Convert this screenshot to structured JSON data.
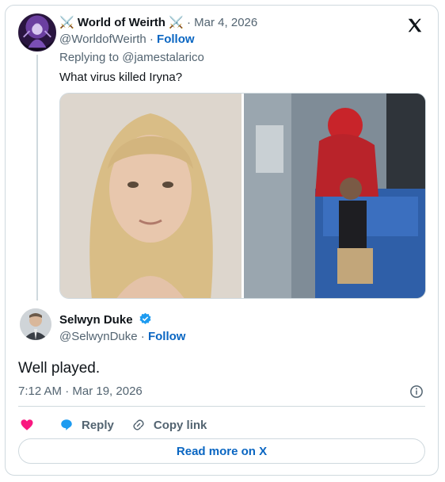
{
  "tweet": {
    "author_name": "World of Weirth",
    "author_emoji_left": "⚔️",
    "author_emoji_right": "⚔️",
    "separator": "·",
    "date": "Mar 4, 2026",
    "handle": "@WorldofWeirth",
    "follow_label": "Follow",
    "replying_to": "Replying to @jamestalarico",
    "text": "What virus killed Iryna?"
  },
  "reply": {
    "author_name": "Selwyn Duke",
    "handle": "@SelwynDuke",
    "follow_label": "Follow",
    "text": "Well played.",
    "timestamp": "7:12 AM · Mar 19, 2026"
  },
  "actions": {
    "reply_label": "Reply",
    "copy_link_label": "Copy link",
    "read_more_label": "Read more on X"
  },
  "colors": {
    "accent": "#0a66c2",
    "heart": "#f91880",
    "verified": "#1d9bf0"
  },
  "icons": [
    "x-logo-icon",
    "heart-icon",
    "reply-bubble-icon",
    "link-icon",
    "info-icon",
    "verified-badge-icon",
    "crossed-swords-icon"
  ]
}
